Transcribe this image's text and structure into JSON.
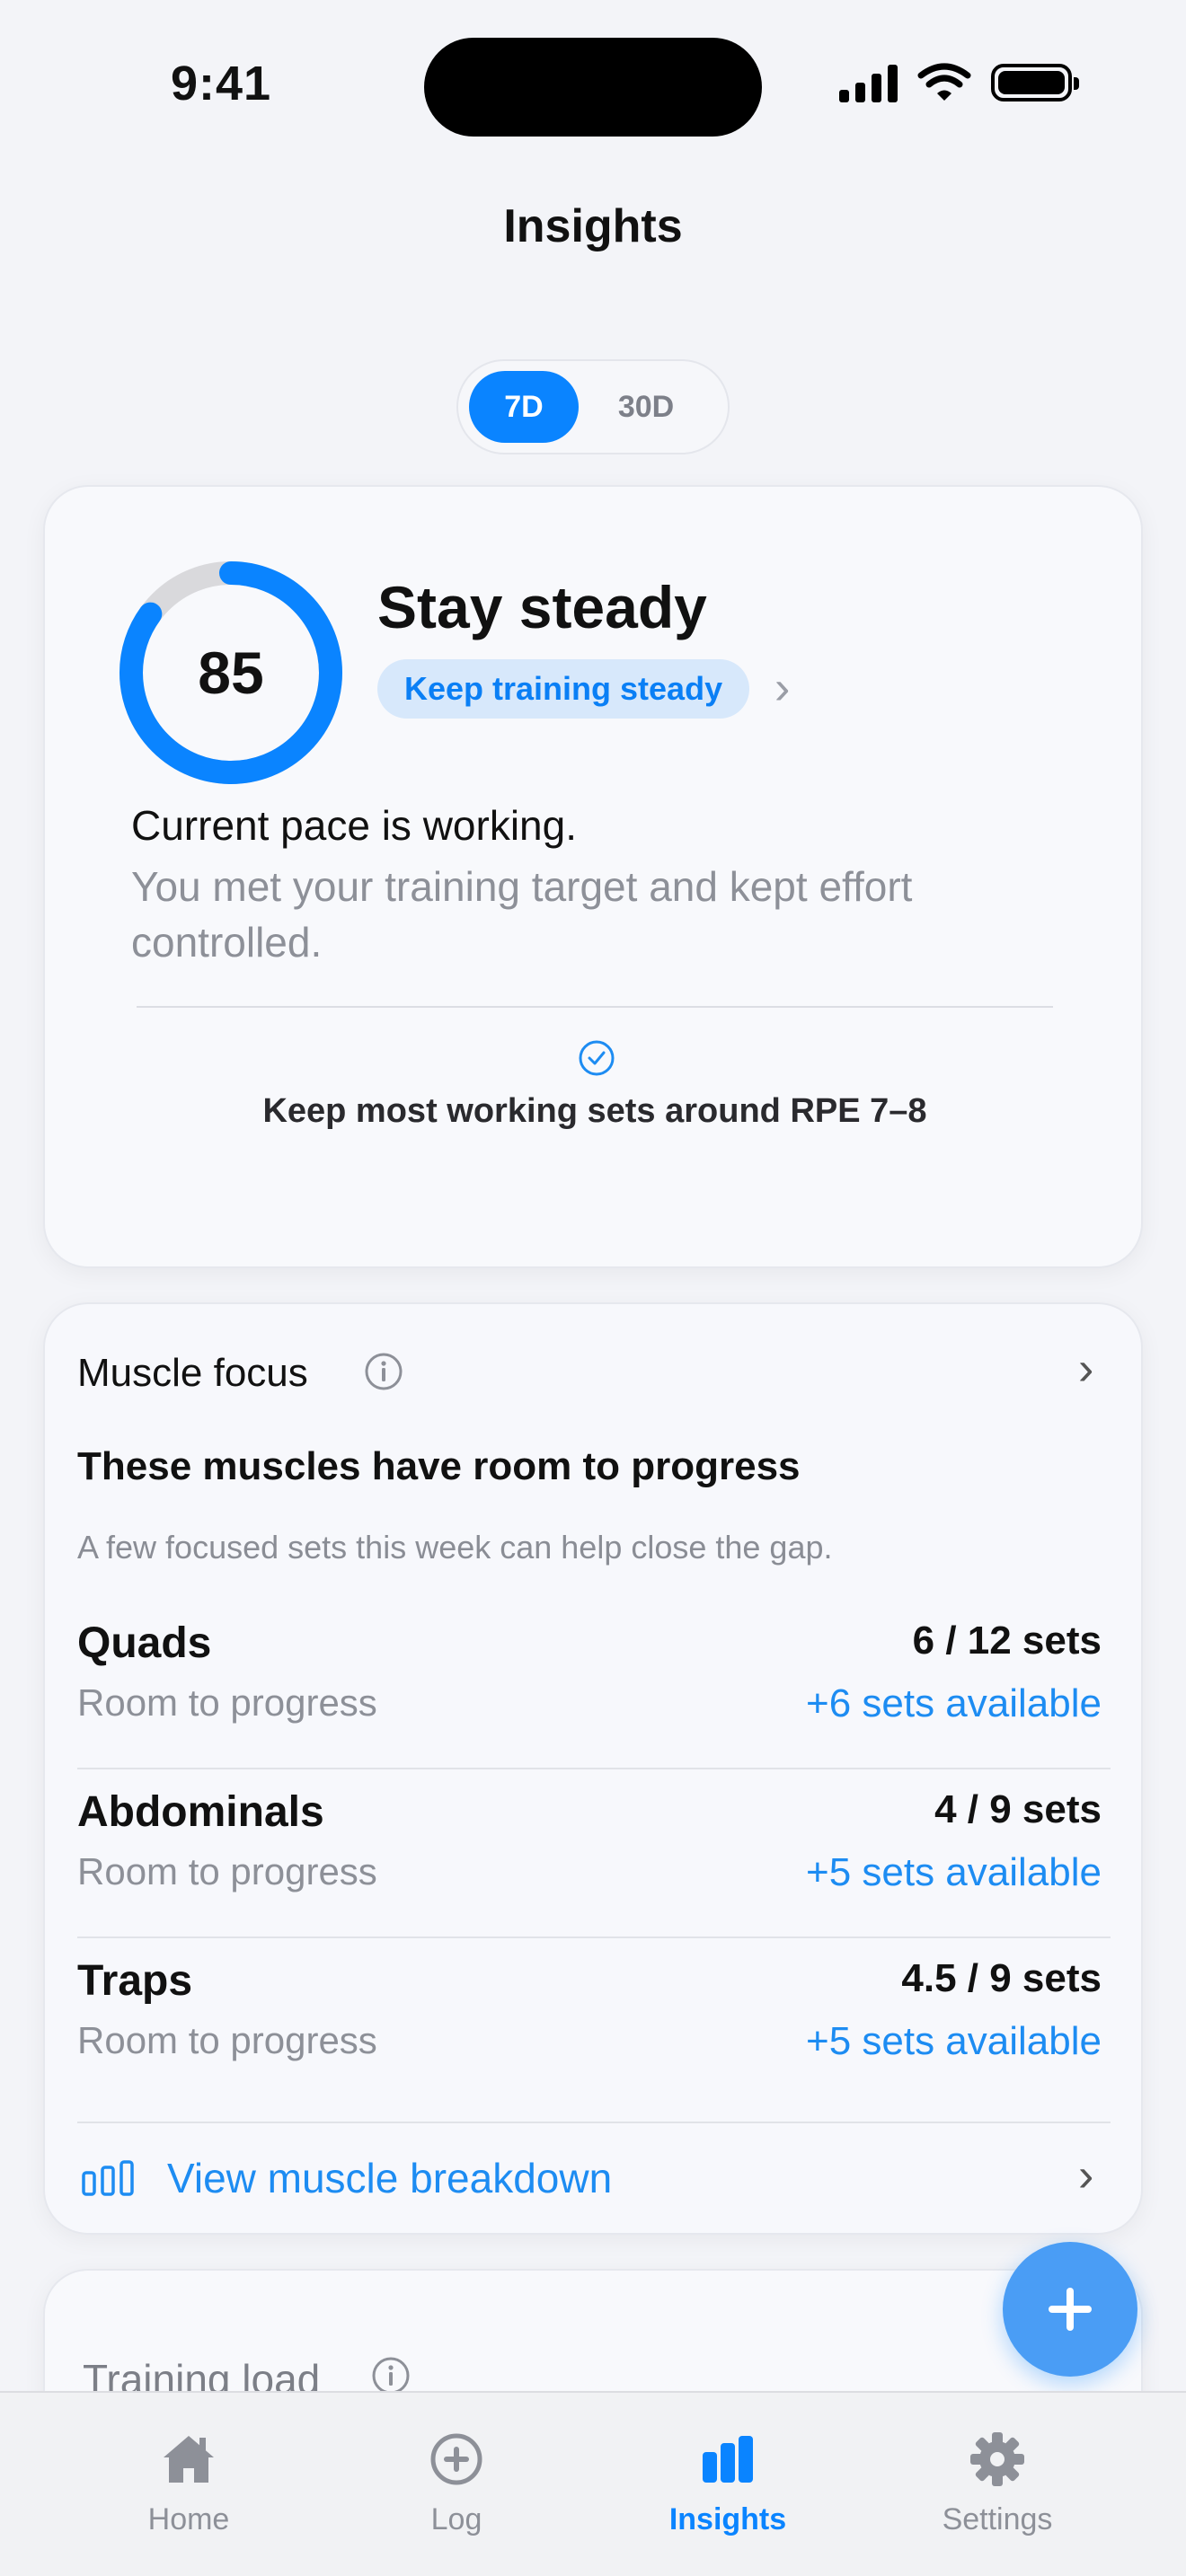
{
  "status_bar": {
    "time": "9:41"
  },
  "header": {
    "title": "Insights"
  },
  "range": {
    "options": [
      "7D",
      "30D"
    ],
    "selected": "7D"
  },
  "score_card": {
    "score": "85",
    "score_fraction": 0.85,
    "title": "Stay steady",
    "pill": "Keep training steady",
    "pace_title": "Current pace is working.",
    "pace_desc": "You met your training target and kept effort controlled.",
    "tip": "Keep most working sets around RPE 7–8"
  },
  "muscle_focus": {
    "title": "Muscle focus",
    "headline": "These muscles have room to progress",
    "subtitle": "A few focused sets this week can help close the gap.",
    "rows": [
      {
        "name": "Quads",
        "status": "Room to progress",
        "sets": "6 / 12 sets",
        "available": "+6 sets available"
      },
      {
        "name": "Abdominals",
        "status": "Room to progress",
        "sets": "4 / 9 sets",
        "available": "+5 sets available"
      },
      {
        "name": "Traps",
        "status": "Room to progress",
        "sets": "4.5 / 9 sets",
        "available": "+5 sets available"
      }
    ],
    "breakdown_label": "View muscle breakdown"
  },
  "training_load": {
    "title": "Training load"
  },
  "tabbar": {
    "items": [
      {
        "label": "Home",
        "icon": "home-icon"
      },
      {
        "label": "Log",
        "icon": "plus-circle-icon"
      },
      {
        "label": "Insights",
        "icon": "bar-chart-icon"
      },
      {
        "label": "Settings",
        "icon": "gear-icon"
      }
    ],
    "active": "Insights"
  },
  "colors": {
    "accent": "#0a84ff",
    "ring_track": "#d9d9dc",
    "pill_bg": "#d7e8fb",
    "fab": "#4a9df5"
  }
}
